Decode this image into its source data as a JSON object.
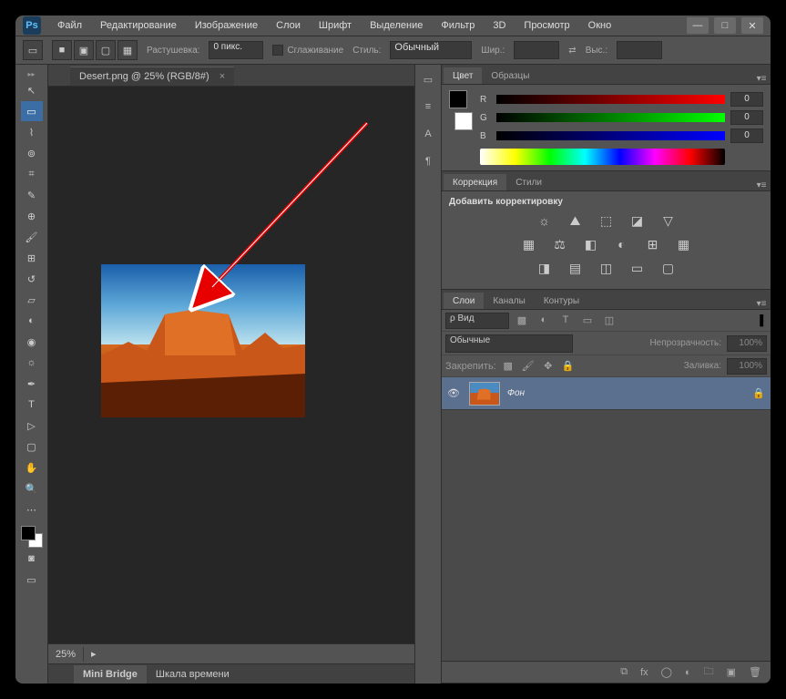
{
  "app": {
    "short": "Ps"
  },
  "window_controls": {
    "min": "—",
    "max": "□",
    "close": "✕"
  },
  "menu": [
    "Файл",
    "Редактирование",
    "Изображение",
    "Слои",
    "Шрифт",
    "Выделение",
    "Фильтр",
    "3D",
    "Просмотр",
    "Окно"
  ],
  "options": {
    "feather_label": "Растушевка:",
    "feather_value": "0 пикс.",
    "antialias": "Сглаживание",
    "style_label": "Стиль:",
    "style_value": "Обычный",
    "width_label": "Шир.:",
    "height_label": "Выс.:"
  },
  "doc_tab": {
    "title": "Desert.png @ 25% (RGB/8#)",
    "close": "×"
  },
  "zoom": "25%",
  "bottom_tabs": [
    "Mini Bridge",
    "Шкала времени"
  ],
  "panel_color": {
    "tabs": [
      "Цвет",
      "Образцы"
    ],
    "channels": [
      {
        "label": "R",
        "value": "0"
      },
      {
        "label": "G",
        "value": "0"
      },
      {
        "label": "B",
        "value": "0"
      }
    ]
  },
  "panel_adjust": {
    "tabs": [
      "Коррекция",
      "Стили"
    ],
    "heading": "Добавить корректировку"
  },
  "panel_layers": {
    "tabs": [
      "Слои",
      "Каналы",
      "Контуры"
    ],
    "filter_label": "ρ Вид",
    "blend_mode": "Обычные",
    "opacity_label": "Непрозрачность:",
    "opacity_value": "100%",
    "lock_label": "Закрепить:",
    "fill_label": "Заливка:",
    "fill_value": "100%",
    "layer_name": "Фон"
  }
}
